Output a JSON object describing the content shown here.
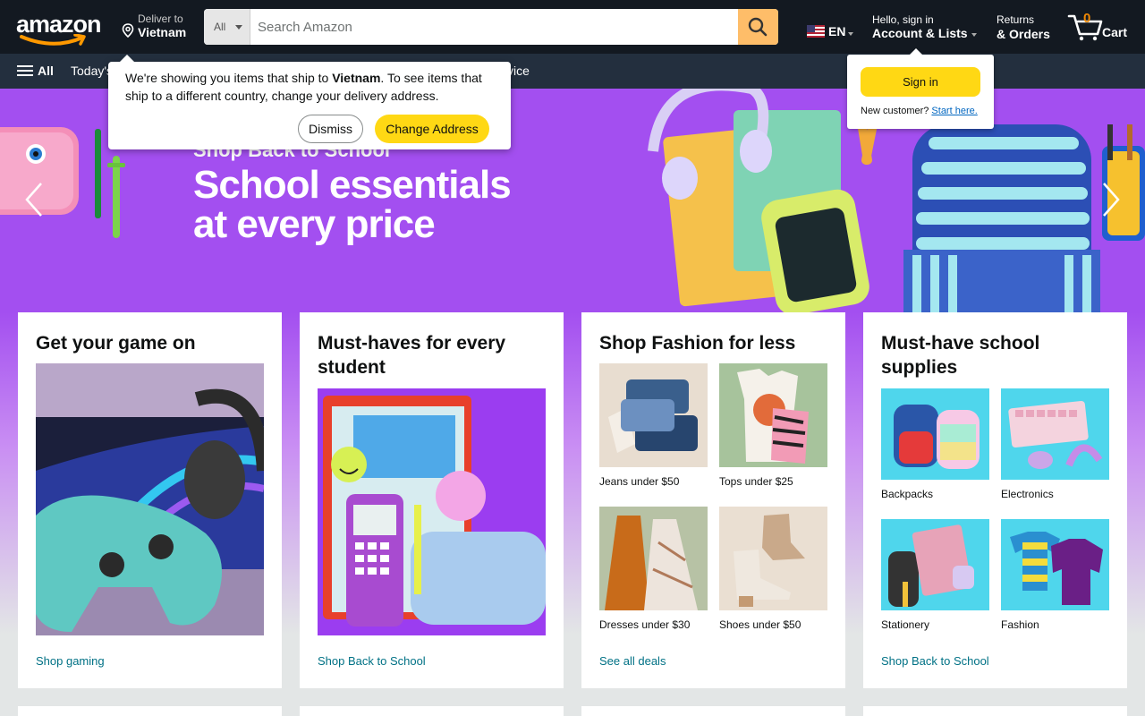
{
  "nav": {
    "logo": "amazon",
    "deliver_line1": "Deliver to",
    "deliver_line2": "Vietnam",
    "search_category": "All",
    "search_placeholder": "Search Amazon",
    "language": "EN",
    "account_line1": "Hello, sign in",
    "account_line2": "Account & Lists",
    "returns_line1": "Returns",
    "returns_line2": "& Orders",
    "cart_count": "0",
    "cart_label": "Cart"
  },
  "subnav": {
    "all_label": "All",
    "items": [
      "Today's",
      "vice"
    ]
  },
  "popover": {
    "msg_prefix": "We're showing you items that ship to ",
    "msg_country": "Vietnam",
    "msg_suffix": ". To see items that ship to a different country, change your delivery address.",
    "dismiss_label": "Dismiss",
    "change_label": "Change Address"
  },
  "signin_popover": {
    "button_label": "Sign in",
    "new_customer": "New customer?",
    "start_here": "Start here."
  },
  "hero": {
    "kicker": "Shop Back to School",
    "headline_line1": "School essentials",
    "headline_line2": "at every price"
  },
  "cards": [
    {
      "title": "Get your game on",
      "link": "Shop gaming"
    },
    {
      "title": "Must-haves for every student",
      "link": "Shop Back to School"
    },
    {
      "title": "Shop Fashion for less",
      "link": "See all deals",
      "tiles": [
        "Jeans under $50",
        "Tops under $25",
        "Dresses under $30",
        "Shoes under $50"
      ]
    },
    {
      "title": "Must-have school supplies",
      "link": "Shop Back to School",
      "tiles": [
        "Backpacks",
        "Electronics",
        "Stationery",
        "Fashion"
      ]
    }
  ],
  "colors": {
    "nav_bg": "#131921",
    "subnav_bg": "#232f3e",
    "hero_bg": "#a34ff0",
    "search_button": "#febd69",
    "primary_button": "#ffd814",
    "link": "#007185"
  }
}
